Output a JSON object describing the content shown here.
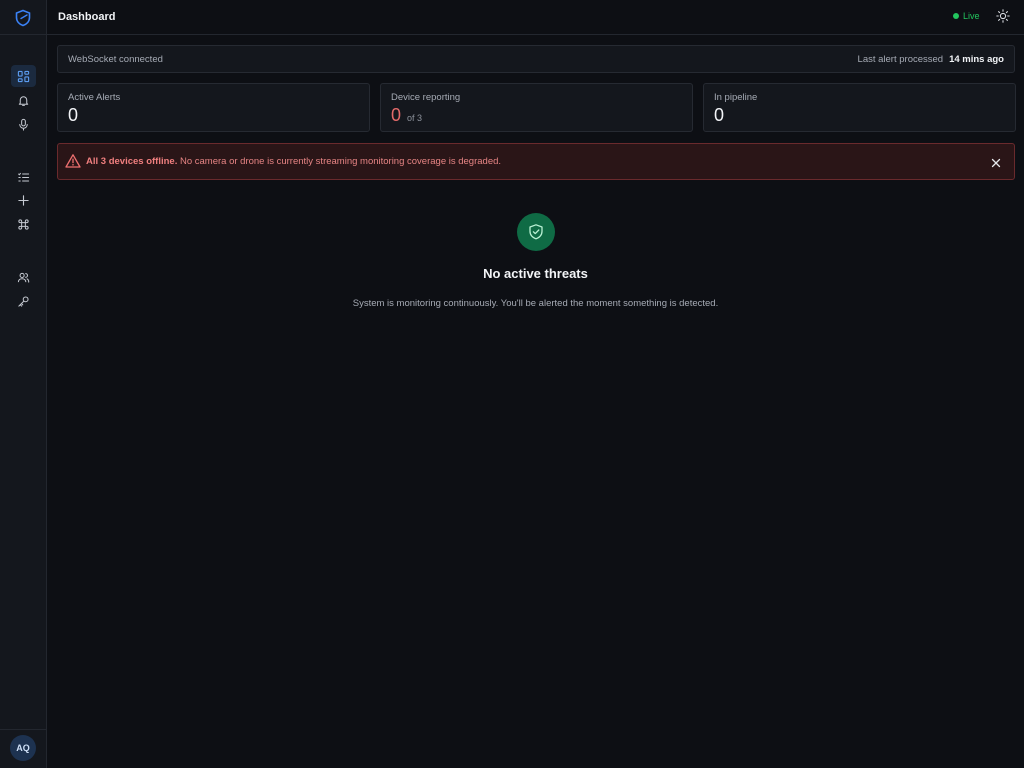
{
  "header": {
    "title": "Dashboard",
    "live_label": "Live"
  },
  "status": {
    "websocket_text": "WebSocket connected",
    "last_alert_label": "Last alert processed",
    "last_alert_value": "14 mins ago"
  },
  "stats": [
    {
      "label": "Active Alerts",
      "value": "0"
    },
    {
      "label": "Device reporting",
      "value": "0",
      "suffix": "of 3"
    },
    {
      "label": "In pipeline",
      "value": "0"
    }
  ],
  "alert": {
    "strong": "All 3 devices offline.",
    "message": " No camera or drone is currently streaming monitoring coverage is degraded."
  },
  "empty_state": {
    "title": "No active threats",
    "description": "System is monitoring continuously. You'll be alerted the moment something is detected."
  },
  "user": {
    "initials": "AQ"
  },
  "sidebar": {
    "items": [
      {
        "icon": "dashboard-grid-icon"
      },
      {
        "icon": "bell-icon"
      },
      {
        "icon": "microphone-icon"
      },
      {
        "icon": "list-icon"
      },
      {
        "icon": "plus-icon"
      },
      {
        "icon": "command-icon"
      },
      {
        "icon": "users-icon"
      },
      {
        "icon": "key-icon"
      }
    ]
  },
  "colors": {
    "accent": "#3b82f6",
    "live": "#22c55e",
    "danger": "#e46a6a",
    "safe": "#0f6b45"
  }
}
